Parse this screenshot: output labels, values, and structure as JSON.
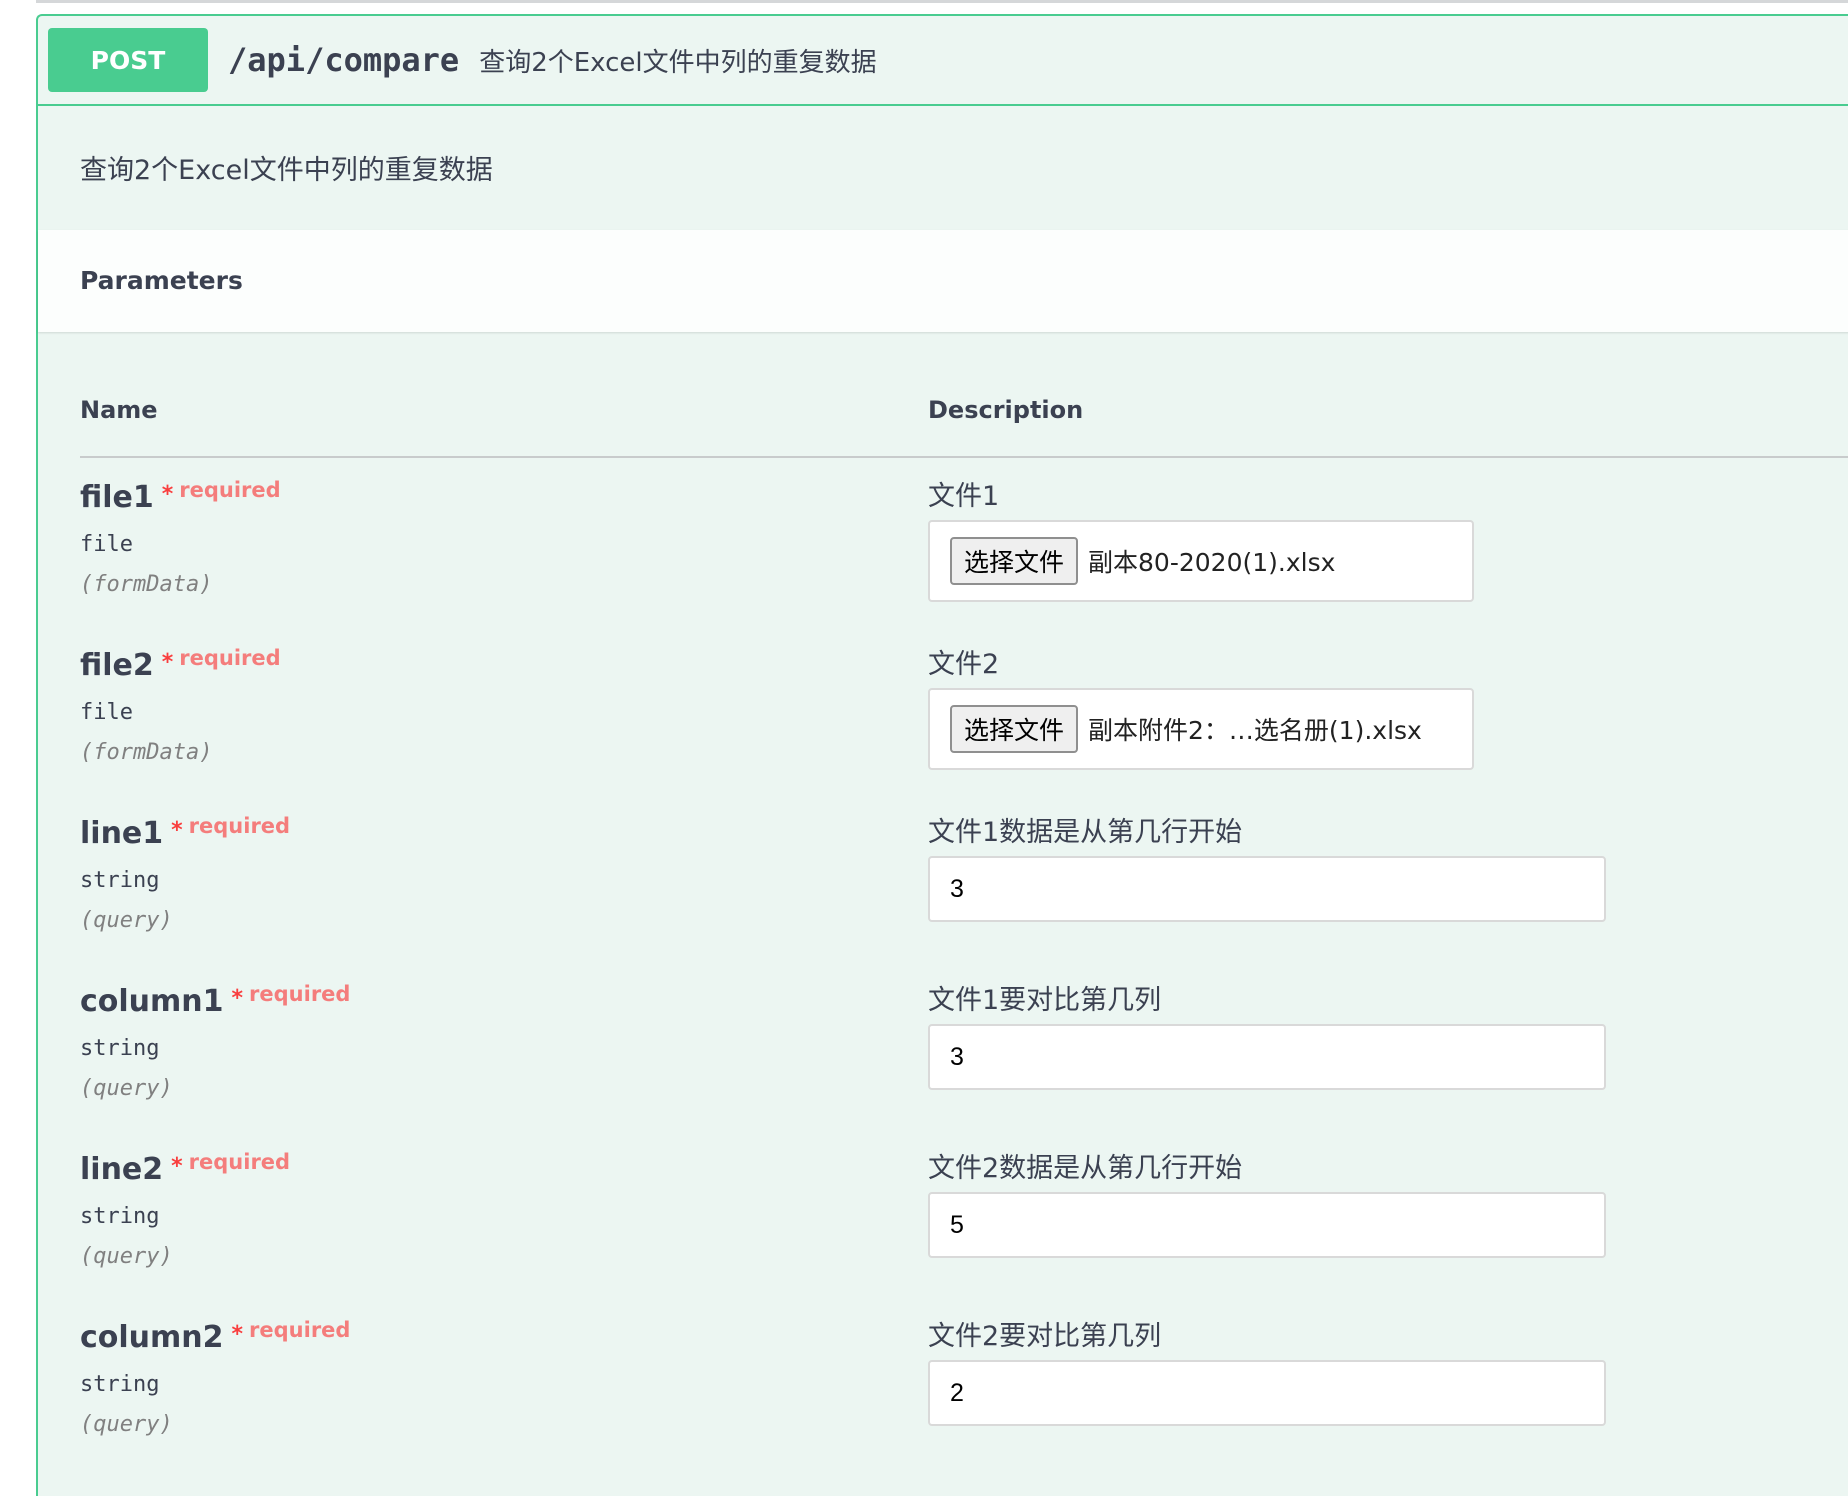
{
  "operation": {
    "method": "POST",
    "path": "/api/compare",
    "summary": "查询2个Excel文件中列的重复数据",
    "description": "查询2个Excel文件中列的重复数据"
  },
  "parameters_title": "Parameters",
  "table_headers": {
    "name": "Name",
    "description": "Description"
  },
  "params": [
    {
      "name": "file1",
      "required_mark": "*",
      "required_label": "required",
      "type": "file",
      "in": "(formData)",
      "description": "文件1",
      "button_label": "选择文件",
      "file_name": "副本80-2020(1).xlsx"
    },
    {
      "name": "file2",
      "required_mark": "*",
      "required_label": "required",
      "type": "file",
      "in": "(formData)",
      "description": "文件2",
      "button_label": "选择文件",
      "file_name": "副本附件2：…选名册(1).xlsx"
    },
    {
      "name": "line1",
      "required_mark": "*",
      "required_label": "required",
      "type": "string",
      "in": "(query)",
      "description": "文件1数据是从第几行开始",
      "value": "3"
    },
    {
      "name": "column1",
      "required_mark": "*",
      "required_label": "required",
      "type": "string",
      "in": "(query)",
      "description": "文件1要对比第几列",
      "value": "3"
    },
    {
      "name": "line2",
      "required_mark": "*",
      "required_label": "required",
      "type": "string",
      "in": "(query)",
      "description": "文件2数据是从第几行开始",
      "value": "5"
    },
    {
      "name": "column2",
      "required_mark": "*",
      "required_label": "required",
      "type": "string",
      "in": "(query)",
      "description": "文件2要对比第几列",
      "value": "2"
    }
  ],
  "colors": {
    "post_green": "#49cc90",
    "block_bg": "#ecf6f2",
    "required_red": "#f93e3e"
  }
}
